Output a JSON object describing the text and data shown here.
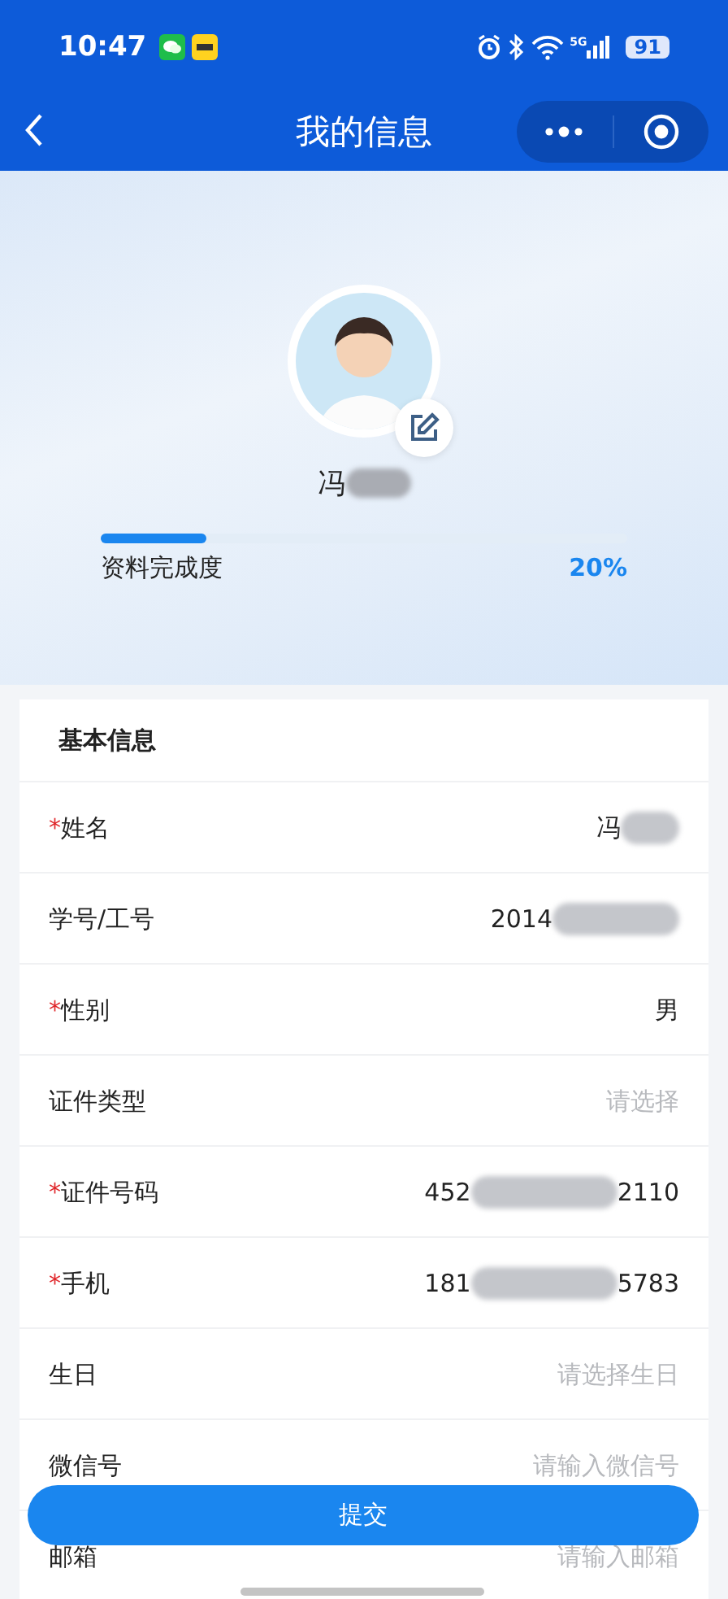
{
  "status_bar": {
    "time": "10:47",
    "network": "5G",
    "battery": "91"
  },
  "nav_bar": {
    "title": "我的信息"
  },
  "profile": {
    "name": "冯",
    "name_redacted": true,
    "completion": {
      "label": "资料完成度",
      "level": 0.2,
      "reading": "20%"
    }
  },
  "basic_info": {
    "title": "基本信息",
    "rows": [
      {
        "label": "姓名",
        "marker": "*",
        "value": "冯",
        "redacted": true
      },
      {
        "label": "学号/工号",
        "value": "2014",
        "redacted": true
      },
      {
        "label": "性别",
        "marker": "*",
        "value": "男"
      },
      {
        "label": "证件类型",
        "placeholder": "请选择"
      },
      {
        "label": "证件号码",
        "marker": "*",
        "value": "452",
        "value_end": "2110",
        "redacted": true
      },
      {
        "label": "手机",
        "marker": "*",
        "value": "181",
        "value_end": "5783",
        "redacted": true
      },
      {
        "label": "生日",
        "placeholder": "请选择生日"
      },
      {
        "label": "微信号",
        "placeholder": "请输入微信号"
      },
      {
        "label": "邮箱",
        "placeholder": "请输入邮箱"
      }
    ]
  },
  "submit_button": {
    "label": "提交"
  }
}
